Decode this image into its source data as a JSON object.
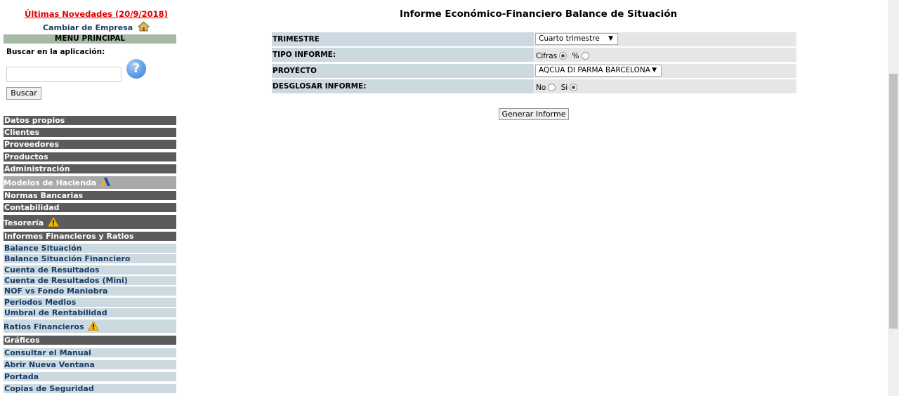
{
  "sidebar": {
    "news_link": "Últimas Novedades (20/9/2018)",
    "change_company": "Cambiar de Empresa",
    "menu_title": "MENU PRINCIPAL",
    "search_label": "Buscar en la aplicación:",
    "search_placeholder": "",
    "help_symbol": "?",
    "search_button": "Buscar",
    "sections": [
      "Datos propios",
      "Clientes",
      "Proveedores",
      "Productos",
      "Administración",
      "Modelos de Hacienda",
      "Normas Bancarias",
      "Contabilidad",
      "Tesorería",
      "Informes Financieros y Ratios"
    ],
    "report_items": [
      "Balance Situación",
      "Balance Situación Financiero",
      "Cuenta de Resultados",
      "Cuenta de Resultados (Mini)",
      "NOF vs Fondo Maniobra",
      "Periodos Medios",
      "Umbral de Rentabilidad",
      "Ratios Financieros"
    ],
    "graficos": "Gráficos",
    "bottom_items": [
      "Consultar el Manual",
      "Abrir Nueva Ventana",
      "Portada",
      "Copias de Seguridad"
    ]
  },
  "main": {
    "title": "Informe Económico-Financiero Balance de Situación",
    "form": {
      "trimestre_label": "TRIMESTRE",
      "trimestre_value": "Cuarto trimestre",
      "tipo_label": "TIPO INFORME:",
      "tipo_option_cifras": "Cifras",
      "tipo_option_pct": "%",
      "tipo_selected": "Cifras",
      "proyecto_label": "PROYECTO",
      "proyecto_value": "AQCUA DI PARMA BARCELONA",
      "desglosar_label": "DESGLOSAR INFORME:",
      "desglosar_option_no": "No",
      "desglosar_option_si": "Si",
      "desglosar_selected": "Si"
    },
    "generate_button": "Generar Informe"
  },
  "colors": {
    "news": "#e00000",
    "menu_title_bg": "#a6b9a4",
    "section_bg": "#5b5b5b",
    "light_item_bg": "#ccd9e0",
    "link_text": "#173c66",
    "value_bg": "#e6e6e6"
  },
  "icons": [
    "house-icon",
    "help-icon",
    "hacienda-logo-icon",
    "warning-icon",
    "chevron-down-icon"
  ]
}
